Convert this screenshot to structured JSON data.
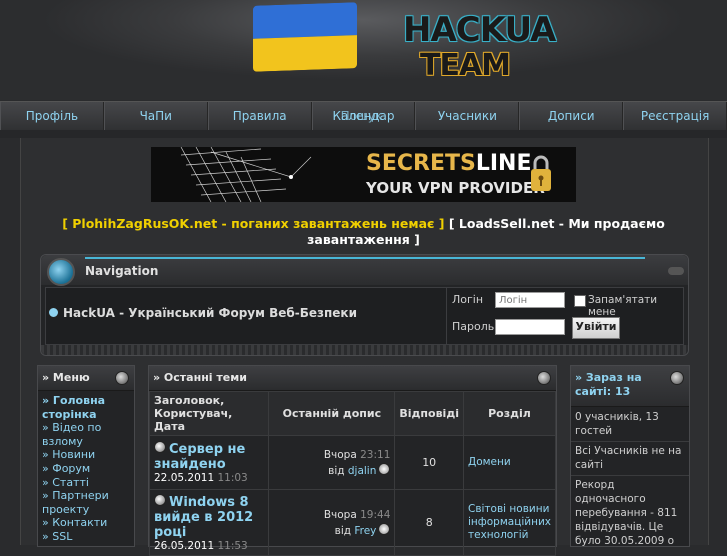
{
  "header": {
    "logo_line1": "HACKUA",
    "logo_line2": "TEAM",
    "colors": {
      "flag_blue": "#2f6fd6",
      "flag_yellow": "#f2c41d",
      "accent": "#8fd3f0"
    }
  },
  "nav": {
    "items": [
      {
        "label": "Профіль"
      },
      {
        "label": "ЧаПи"
      },
      {
        "label": "Правила"
      },
      {
        "label": "Календар"
      },
      {
        "label": "Учасники"
      },
      {
        "label": "Дописи"
      },
      {
        "label": "Реєстрація"
      }
    ],
    "overlap_label": "Пошук"
  },
  "banner": {
    "brand_a": "SECRETS",
    "brand_b": "LINE",
    "tagline": "YOUR VPN PROVIDER"
  },
  "ads": {
    "ad1": "[ PlohihZagRusOK.net - поганих завантажень немає ]",
    "ad2": "[ LoadsSell.net - Ми продаємо завантаження ]"
  },
  "navigation": {
    "title": "Navigation",
    "site_name": "HackUA - Український Форум Веб-Безпеки",
    "login_label": "Логін",
    "login_placeholder": "Логін",
    "remember_label": "Запам'ятати мене",
    "password_label": "Пароль",
    "submit": "Увійти"
  },
  "menu": {
    "title": "» Меню",
    "items": [
      {
        "label": "» Головна сторінка",
        "bold": true
      },
      {
        "label": "» Відео по взлому"
      },
      {
        "label": "» Новини"
      },
      {
        "label": "» Форум"
      },
      {
        "label": "» Статті"
      },
      {
        "label": "» Партнери проекту"
      },
      {
        "label": "» Контакти"
      },
      {
        "label": "» SSL"
      }
    ]
  },
  "latest": {
    "title": "» Останні теми",
    "columns": [
      "Заголовок, Користувач, Дата",
      "Останній допис",
      "Відповіді",
      "Розділ"
    ],
    "rows": [
      {
        "title": "Сервер не знайдено",
        "date": "22.05.2011",
        "time": "11:03",
        "last_day": "Вчора",
        "last_time": "23:11",
        "by": "від",
        "last_user": "djalin",
        "replies": "10",
        "section": "Домени"
      },
      {
        "title": "Windows 8 вийде в 2012 році",
        "date": "26.05.2011",
        "time": "11:53",
        "last_day": "Вчора",
        "last_time": "19:44",
        "by": "від",
        "last_user": "Frey",
        "replies": "8",
        "section": "Світові новини інформаційних технологій"
      }
    ]
  },
  "online": {
    "title": "» Зараз на сайті: 13",
    "rows": [
      "0 учасників, 13 гостей",
      "Всі Учасників не на сайті",
      "Рекорд одночасного перебування - 811 відвідувачів. Це було 30.05.2009 о"
    ]
  }
}
